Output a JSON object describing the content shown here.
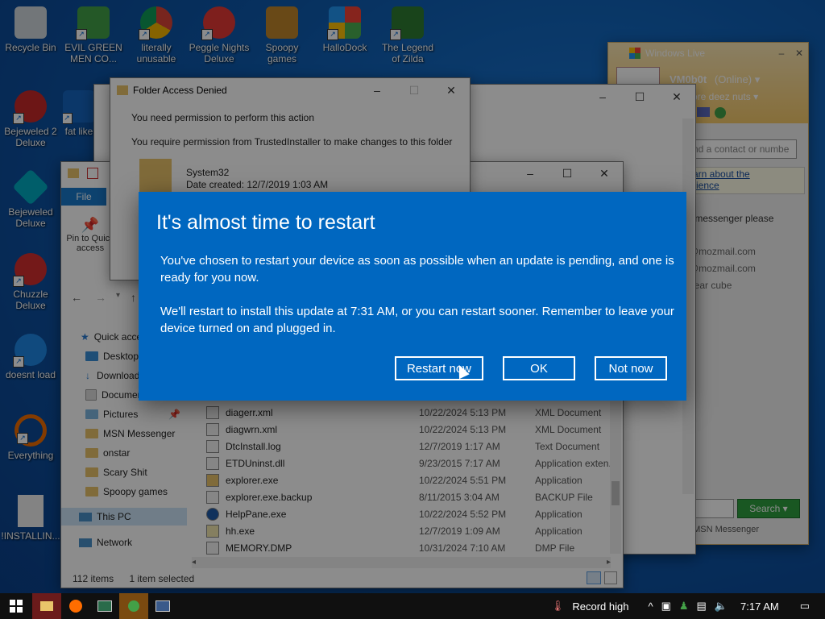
{
  "desktop": {
    "icons": [
      {
        "label": "Recycle Bin",
        "color": "#cfd8dc"
      },
      {
        "label": "EVIL GREEN MEN CO...",
        "color": "#43a047"
      },
      {
        "label": "literally unusable",
        "color": "#fbc02d"
      },
      {
        "label": "Peggle Nights Deluxe",
        "color": "#e53935"
      },
      {
        "label": "Spoopy games",
        "color": "#c0862a"
      },
      {
        "label": "HalloDock",
        "color": "#f57c00"
      },
      {
        "label": "The Legend of Zilda",
        "color": "#2e7d32"
      },
      {
        "label": "Bejeweled 2 Deluxe",
        "color": "#c62828"
      },
      {
        "label": "fat like",
        "color": "#1565c0"
      },
      {
        "label": "Bejeweled Deluxe",
        "color": "#00acc1"
      },
      {
        "label": "Chuzzle Deluxe",
        "color": "#d32f2f"
      },
      {
        "label": "doesnt load",
        "color": "#1e88e5"
      },
      {
        "label": "Everything",
        "color": "#ef6c00"
      },
      {
        "label": "!INSTALLIN...",
        "color": "#eeeeee"
      }
    ]
  },
  "folder_dialog": {
    "title": "Folder Access Denied",
    "heading": "You need permission to perform this action",
    "message": "You require permission from TrustedInstaller to make changes to this folder",
    "item_name": "System32",
    "item_date": "Date created: 12/7/2019 1:03 AM"
  },
  "explorer": {
    "ribbon_tab": "File",
    "pin_label": "Pin to Quick access",
    "nav": [
      {
        "label": "Quick access"
      },
      {
        "label": "Desktop"
      },
      {
        "label": "Downloads"
      },
      {
        "label": "Documents"
      },
      {
        "label": "Pictures"
      },
      {
        "label": "MSN Messenger"
      },
      {
        "label": "onstar"
      },
      {
        "label": "Scary Shit"
      },
      {
        "label": "Spoopy games"
      },
      {
        "label": "This PC"
      },
      {
        "label": "Network"
      }
    ],
    "files": [
      {
        "name": "diagerr.xml",
        "date": "10/22/2024 5:13 PM",
        "type": "XML Document"
      },
      {
        "name": "diagwrn.xml",
        "date": "10/22/2024 5:13 PM",
        "type": "XML Document"
      },
      {
        "name": "DtcInstall.log",
        "date": "12/7/2019 1:17 AM",
        "type": "Text Document"
      },
      {
        "name": "ETDUninst.dll",
        "date": "9/23/2015 7:17 AM",
        "type": "Application exten..."
      },
      {
        "name": "explorer.exe",
        "date": "10/22/2024 5:51 PM",
        "type": "Application"
      },
      {
        "name": "explorer.exe.backup",
        "date": "8/11/2015 3:04 AM",
        "type": "BACKUP File"
      },
      {
        "name": "HelpPane.exe",
        "date": "10/22/2024 5:52 PM",
        "type": "Application"
      },
      {
        "name": "hh.exe",
        "date": "12/7/2019 1:09 AM",
        "type": "Application"
      },
      {
        "name": "MEMORY.DMP",
        "date": "10/31/2024 7:10 AM",
        "type": "DMP File"
      }
    ],
    "status_items": "112 items",
    "status_selected": "1 item selected"
  },
  "messenger": {
    "title": "Windows Live",
    "user": "VM0b0t",
    "status": "(Online)",
    "personal_msg": "ore deez nuts",
    "search_placeholder": "nd a contact or numbe",
    "learn_link": "arn about the",
    "learn_link2": "rience",
    "contacts": [
      {
        "label": "- messenger please"
      },
      {
        "label": "@mozmail.com"
      },
      {
        "label": "@mozmail.com"
      },
      {
        "label": "bear cube"
      }
    ],
    "search_button": "Search",
    "footer": "The Future of MSN Messenger"
  },
  "restart_dialog": {
    "title": "It's almost time to restart",
    "para1": "You've chosen to restart your device as soon as possible when an update is pending, and one is ready for you now.",
    "para2": "We'll restart to install this update at 7:31 AM, or you can restart sooner. Remember to leave your device turned on and plugged in.",
    "restart_label": "Restart now",
    "ok_label": "OK",
    "notnow_label": "Not now"
  },
  "taskbar": {
    "weather": "Record high",
    "time": "7:17 AM"
  }
}
